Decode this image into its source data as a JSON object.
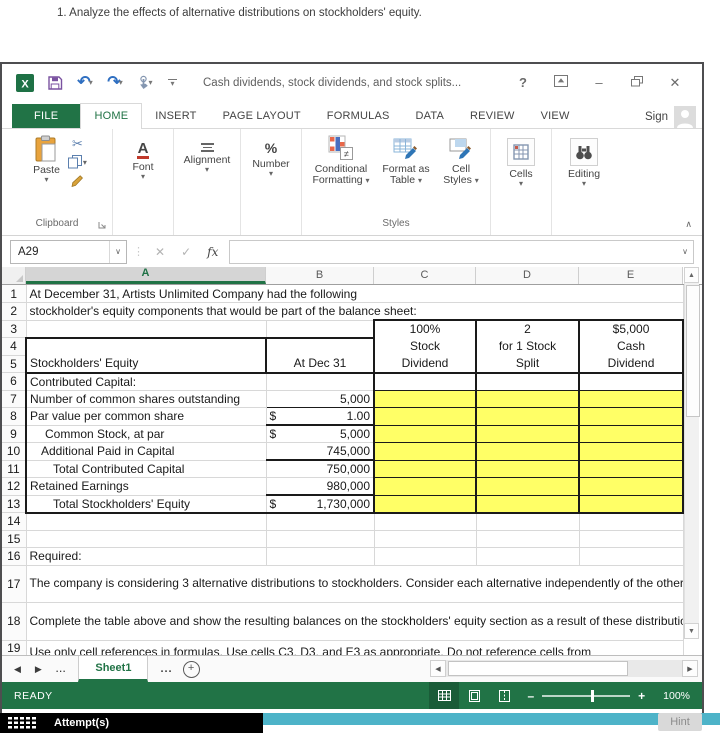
{
  "page": {
    "instruction": "1. Analyze the effects of alternative distributions on stockholders' equity.",
    "attempts_label": "Attempt(s)",
    "hint_label": "Hint"
  },
  "titlebar": {
    "title": "Cash dividends, stock dividends, and stock splits...",
    "help": "?",
    "minimize": "–",
    "close": "✕"
  },
  "ribbon": {
    "file_tab": "FILE",
    "tabs": [
      "HOME",
      "INSERT",
      "PAGE LAYOUT",
      "FORMULAS",
      "DATA",
      "REVIEW",
      "VIEW"
    ],
    "active_tab": "HOME",
    "sign_in": "Sign",
    "clipboard": {
      "group": "Clipboard",
      "paste": "Paste"
    },
    "font": {
      "label": "Font"
    },
    "alignment": {
      "label": "Alignment"
    },
    "number": {
      "label": "Number",
      "glyph": "%"
    },
    "styles": {
      "group": "Styles",
      "conditional_formatting": "Conditional Formatting",
      "format_as_table": "Format as Table",
      "cell_styles": "Cell Styles"
    },
    "cells": {
      "label": "Cells"
    },
    "editing": {
      "label": "Editing"
    }
  },
  "formula_bar": {
    "name_box": "A29",
    "fx": "fx",
    "formula": ""
  },
  "grid": {
    "columns": [
      "A",
      "B",
      "C",
      "D",
      "E"
    ],
    "selected_column": "A",
    "row_numbers": [
      "1",
      "2",
      "3",
      "4",
      "5",
      "6",
      "7",
      "8",
      "9",
      "10",
      "11",
      "12",
      "13",
      "14",
      "15",
      "16",
      "17",
      "18",
      "19"
    ],
    "cells": {
      "A1": "At December 31,  Artists Unlimited Company had the following",
      "A2": "stockholder's equity components that would be part of the balance sheet:",
      "C3": "100%",
      "D3": "2",
      "E3": "$5,000",
      "C4": "Stock",
      "D4": "for 1 Stock",
      "E4": "Cash",
      "A5": "Stockholders' Equity",
      "B5": "At Dec 31",
      "C5": "Dividend",
      "D5": "Split",
      "E5": "Dividend",
      "A6": "Contributed Capital:",
      "A7": "Number of common shares outstanding",
      "B7": "5,000",
      "A8": "Par value per common share",
      "B8": {
        "cur": "$",
        "val": "1.00"
      },
      "A9": "Common Stock, at par",
      "B9": {
        "cur": "$",
        "val": "5,000"
      },
      "A10": "Additional Paid in Capital",
      "B10": "745,000",
      "A11": "Total Contributed Capital",
      "B11": "750,000",
      "A12": "Retained Earnings",
      "B12": "980,000",
      "A13": "Total Stockholders' Equity",
      "B13": {
        "cur": "$",
        "val": "1,730,000"
      },
      "A16": "Required:",
      "A17": "The company is considering 3 alternative distributions to stockholders.  Consider each alternative independently of the others.",
      "A18": "Complete the table above and show the resulting balances on the stockholders' equity section as a result of these distributions.",
      "A19": "Use only cell references in formulas.  Use cells C3, D3, and E3 as appropriate.  Do not reference cells from"
    }
  },
  "sheet_bar": {
    "active_sheet": "Sheet1",
    "overflow_left": "...",
    "overflow_right": "..."
  },
  "status_bar": {
    "mode": "READY",
    "zoom_level": "100%"
  },
  "icons": {
    "dropdown": "▾",
    "scissors": "✂",
    "check": "✓",
    "x": "✕",
    "undo": "↶",
    "redo": "↷",
    "collapse_ribbon": "∧",
    "left_arrow": "◀",
    "right_arrow": "▶",
    "up_arrow": "▲",
    "down_arrow": "▼",
    "name_box_dd": "∨",
    "formula_dd": "∨",
    "plus": "+",
    "zoom_out": "–",
    "zoom_in": "+"
  }
}
